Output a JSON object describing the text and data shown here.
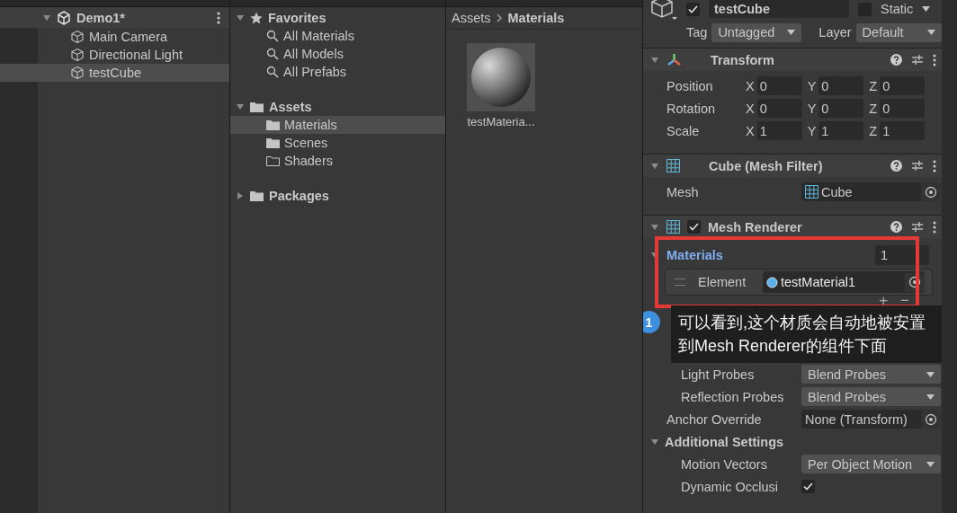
{
  "hierarchy": {
    "scene": {
      "label": "Demo1*",
      "expanded": true,
      "children": [
        {
          "label": "Main Camera",
          "selected": false
        },
        {
          "label": "Directional Light",
          "selected": false
        },
        {
          "label": "testCube",
          "selected": true
        }
      ]
    }
  },
  "project_tree": [
    {
      "label": "Favorites",
      "kind": "favorites",
      "expanded": true,
      "children": [
        {
          "label": "All Materials",
          "kind": "search",
          "selected": false
        },
        {
          "label": "All Models",
          "kind": "search",
          "selected": false
        },
        {
          "label": "All Prefabs",
          "kind": "search",
          "selected": false
        }
      ]
    },
    {
      "label": "Assets",
      "kind": "folder",
      "expanded": true,
      "children": [
        {
          "label": "Materials",
          "kind": "folder",
          "selected": true
        },
        {
          "label": "Scenes",
          "kind": "folder",
          "selected": false
        },
        {
          "label": "Shaders",
          "kind": "empty-folder",
          "selected": false
        }
      ]
    },
    {
      "label": "Packages",
      "kind": "folder",
      "expanded": false
    }
  ],
  "breadcrumb": [
    "Assets",
    "Materials"
  ],
  "assets": [
    {
      "label": "testMateria...",
      "selected": false
    }
  ],
  "inspector": {
    "object": {
      "active": true,
      "name": "testCube",
      "static": false,
      "static_label": "Static",
      "tag_label": "Tag",
      "tag": "Untagged",
      "layer_label": "Layer",
      "layer": "Default"
    },
    "components": [
      {
        "kind": "transform",
        "title": "Transform",
        "expanded": true,
        "fields": [
          {
            "kind": "vector3",
            "label": "Position",
            "values": [
              {
                "axis": "X",
                "value": "0"
              },
              {
                "axis": "Y",
                "value": "0"
              },
              {
                "axis": "Z",
                "value": "0"
              }
            ]
          },
          {
            "kind": "vector3",
            "label": "Rotation",
            "values": [
              {
                "axis": "X",
                "value": "0"
              },
              {
                "axis": "Y",
                "value": "0"
              },
              {
                "axis": "Z",
                "value": "0"
              }
            ]
          },
          {
            "kind": "vector3",
            "label": "Scale",
            "values": [
              {
                "axis": "X",
                "value": "1"
              },
              {
                "axis": "Y",
                "value": "1"
              },
              {
                "axis": "Z",
                "value": "1"
              }
            ]
          }
        ]
      },
      {
        "kind": "mesh",
        "title": "Cube (Mesh Filter)",
        "expanded": true,
        "fields": [
          {
            "kind": "mesh-object",
            "label": "Mesh",
            "value": "Cube"
          }
        ]
      },
      {
        "kind": "mesh",
        "title": "Mesh Renderer",
        "expanded": true,
        "enabled": true,
        "fields": [
          {
            "kind": "array",
            "label": "Materials",
            "expanded": true,
            "count": "1"
          },
          {
            "kind": "element",
            "label": "Element",
            "value": "testMaterial1"
          },
          {
            "kind": "buttons",
            "add": "+",
            "remove": "−"
          },
          {
            "kind": "foldout"
          },
          {
            "kind": "foldout2"
          },
          {
            "kind": "dropdown",
            "label": "Light Probes",
            "value": "Blend Probes"
          },
          {
            "kind": "dropdown",
            "label": "Reflection Probes",
            "value": "Blend Probes"
          },
          {
            "kind": "object",
            "label": "Anchor Override",
            "value": "None (Transform)"
          },
          {
            "kind": "section",
            "label": "Additional Settings",
            "expanded": true
          },
          {
            "kind": "dropdown",
            "label": "Motion Vectors",
            "value": "Per Object Motion"
          },
          {
            "kind": "checkbox",
            "label": "Dynamic Occlusi",
            "checked": true
          }
        ]
      }
    ]
  },
  "annotation": {
    "number": "1",
    "text": "可以看到,这个材质会自动地被安置到Mesh Renderer的组件下面"
  }
}
